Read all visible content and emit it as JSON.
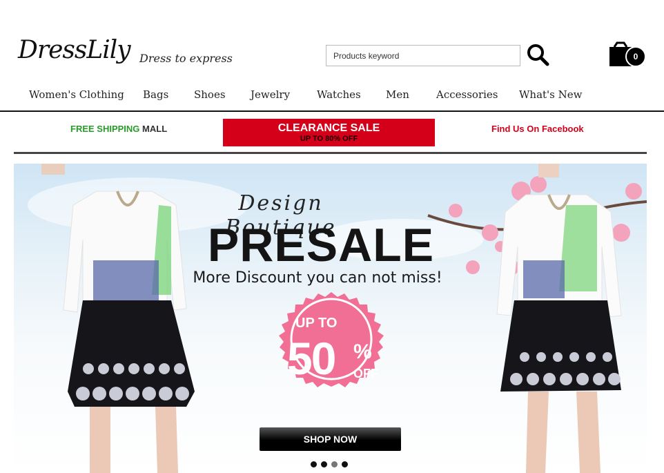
{
  "header": {
    "logo_text": "DressLily",
    "tagline": "Dress to express",
    "search_placeholder": "Products keyword",
    "cart_count": "0"
  },
  "nav": {
    "items": [
      "Women's Clothing",
      "Bags",
      "Shoes",
      "Jewelry",
      "Watches",
      "Men",
      "Accessories",
      "What's New"
    ]
  },
  "promo": {
    "free_shipping_green": "FREE SHIPPING",
    "free_shipping_dark": "MALL",
    "clearance_title": "CLEARANCE SALE",
    "clearance_sub": "UP TO 80% OFF",
    "facebook": "Find Us On Facebook"
  },
  "banner": {
    "script_title": "Design Boutique",
    "headline": "PRESALE",
    "subline": "More Discount you can not miss!",
    "badge_upto": "UP TO",
    "badge_value": "50",
    "badge_percent": "%",
    "badge_off": "OFF",
    "cta": "SHOP NOW",
    "slides": 4,
    "active_slide": 3
  },
  "colors": {
    "clearance_red": "#d4001a",
    "free_shipping_green": "#2a9a2a",
    "badge_pink": "#f16f95",
    "sky_blue": "#cfe5f5"
  }
}
